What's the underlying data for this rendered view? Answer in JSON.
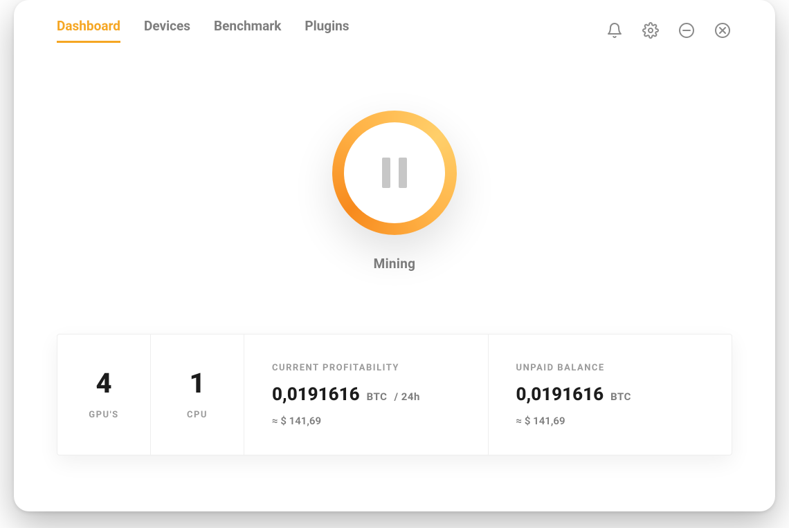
{
  "accent": "#f5a623",
  "nav": {
    "tabs": [
      "Dashboard",
      "Devices",
      "Benchmark",
      "Plugins"
    ],
    "active_index": 0
  },
  "status": {
    "label": "Mining",
    "state": "running"
  },
  "hardware": {
    "gpu": {
      "count": "4",
      "label": "GPU'S"
    },
    "cpu": {
      "count": "1",
      "label": "CPU"
    }
  },
  "profitability": {
    "heading": "CURRENT PROFITABILITY",
    "btc_value": "0,0191616",
    "btc_unit": "BTC",
    "period": "/ 24h",
    "fiat_approx": "≈ $ 141,69"
  },
  "balance": {
    "heading": "UNPAID BALANCE",
    "btc_value": "0,0191616",
    "btc_unit": "BTC",
    "fiat_approx": "≈ $ 141,69"
  }
}
